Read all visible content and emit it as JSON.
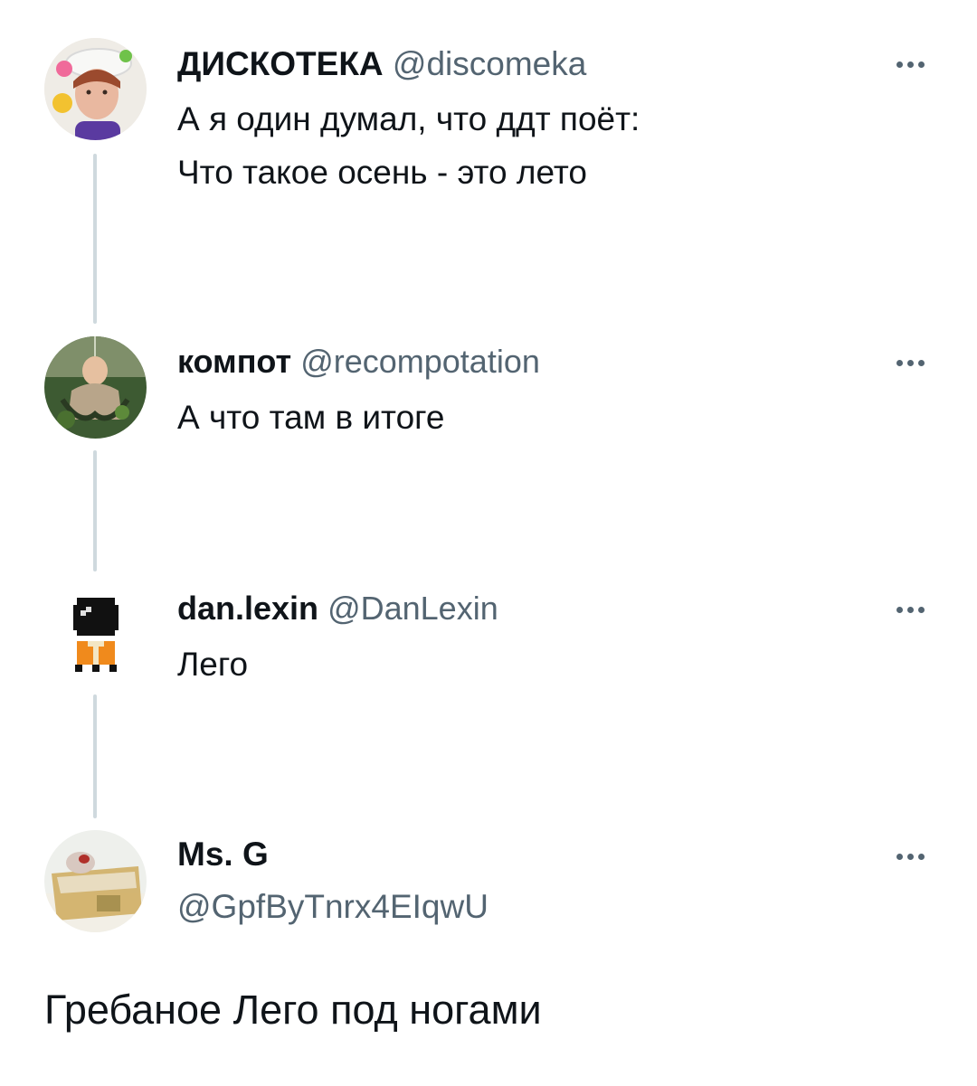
{
  "thread": [
    {
      "display_name": "ДИСКОТЕКА",
      "handle": "@discomeka",
      "text_lines": [
        "А я один думал, что ддт поёт:",
        "Что такое осень - это лето"
      ],
      "avatar_icon": "user-avatar-photo-icon",
      "more_icon": "more-horizontal-icon"
    },
    {
      "display_name": "компот",
      "handle": "@recompotation",
      "text_lines": [
        "А что там в итоге"
      ],
      "avatar_icon": "user-avatar-photo-icon",
      "more_icon": "more-horizontal-icon"
    },
    {
      "display_name": "dan.lexin",
      "handle": "@DanLexin",
      "text_lines": [
        "Лего"
      ],
      "avatar_icon": "pixel-art-avatar-icon",
      "more_icon": "more-horizontal-icon"
    },
    {
      "display_name": "Ms. G",
      "handle": "@GpfByTnrx4EIqwU",
      "text_lines": [],
      "avatar_icon": "user-avatar-photo-icon",
      "more_icon": "more-horizontal-icon"
    }
  ],
  "quote_text": "Гребаное Лего под ногами",
  "colors": {
    "text": "#0f1419",
    "secondary": "#536471",
    "thread_line": "#cfd9de",
    "background": "#ffffff"
  }
}
